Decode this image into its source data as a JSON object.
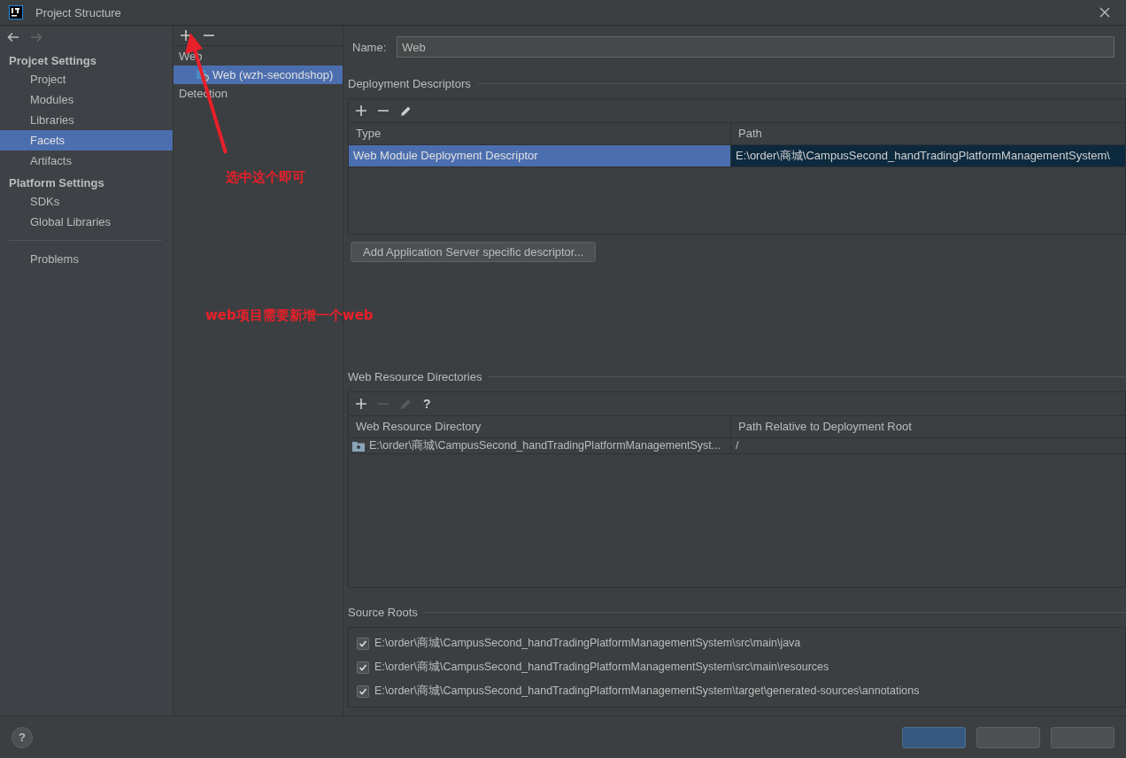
{
  "window": {
    "title": "Project Structure"
  },
  "sidebar": {
    "sections": [
      {
        "heading": "Projcet Settings",
        "items": [
          {
            "label": "Project",
            "selected": false
          },
          {
            "label": "Modules",
            "selected": false
          },
          {
            "label": "Libraries",
            "selected": false
          },
          {
            "label": "Facets",
            "selected": true
          },
          {
            "label": "Artifacts",
            "selected": false
          }
        ]
      },
      {
        "heading": "Platform Settings",
        "items": [
          {
            "label": "SDKs",
            "selected": false
          },
          {
            "label": "Global Libraries",
            "selected": false
          }
        ]
      }
    ],
    "extra_items": [
      {
        "label": "Problems",
        "selected": false
      }
    ]
  },
  "facets_tree": {
    "items": [
      {
        "label": "Web",
        "selected": false,
        "children": [
          {
            "label": "Web (wzh-secondshop)",
            "selected": true
          }
        ]
      },
      {
        "label": "Detection",
        "selected": false
      }
    ]
  },
  "name_field": {
    "label": "Name:",
    "value": "Web"
  },
  "deployment_descriptors": {
    "title": "Deployment Descriptors",
    "columns": [
      "Type",
      "Path"
    ],
    "rows": [
      {
        "cells": [
          "Web Module Deployment Descriptor",
          "E:\\order\\商城\\CampusSecond_handTradingPlatformManagementSystem\\"
        ],
        "selected": true
      }
    ],
    "button": "Add Application Server specific descriptor..."
  },
  "web_resource_directories": {
    "title": "Web Resource Directories",
    "toolbar": [
      {
        "kind": "add",
        "disabled": false
      },
      {
        "kind": "remove",
        "disabled": true
      },
      {
        "kind": "edit",
        "disabled": true
      },
      {
        "kind": "help",
        "label": "?",
        "disabled": false
      }
    ],
    "columns": [
      "Web Resource Directory",
      "Path Relative to Deployment Root"
    ],
    "rows": [
      {
        "cells": [
          "E:\\order\\商城\\CampusSecond_handTradingPlatformManagementSyst...",
          "/"
        ],
        "selected": false
      }
    ]
  },
  "source_roots": {
    "title": "Source Roots",
    "items": [
      {
        "path": "E:\\order\\商城\\CampusSecond_handTradingPlatformManagementSystem\\src\\main\\java",
        "checked": true
      },
      {
        "path": "E:\\order\\商城\\CampusSecond_handTradingPlatformManagementSystem\\src\\main\\resources",
        "checked": true
      },
      {
        "path": "E:\\order\\商城\\CampusSecond_handTradingPlatformManagementSystem\\target\\generated-sources\\annotations",
        "checked": true
      }
    ]
  },
  "annotations": [
    {
      "text": "选中这个即可"
    },
    {
      "text": "web项目需要新增一个web"
    }
  ],
  "footer": {
    "help": "?",
    "buttons": [
      {
        "kind": "primary"
      },
      {
        "kind": "secondary"
      },
      {
        "kind": "secondary"
      }
    ]
  }
}
